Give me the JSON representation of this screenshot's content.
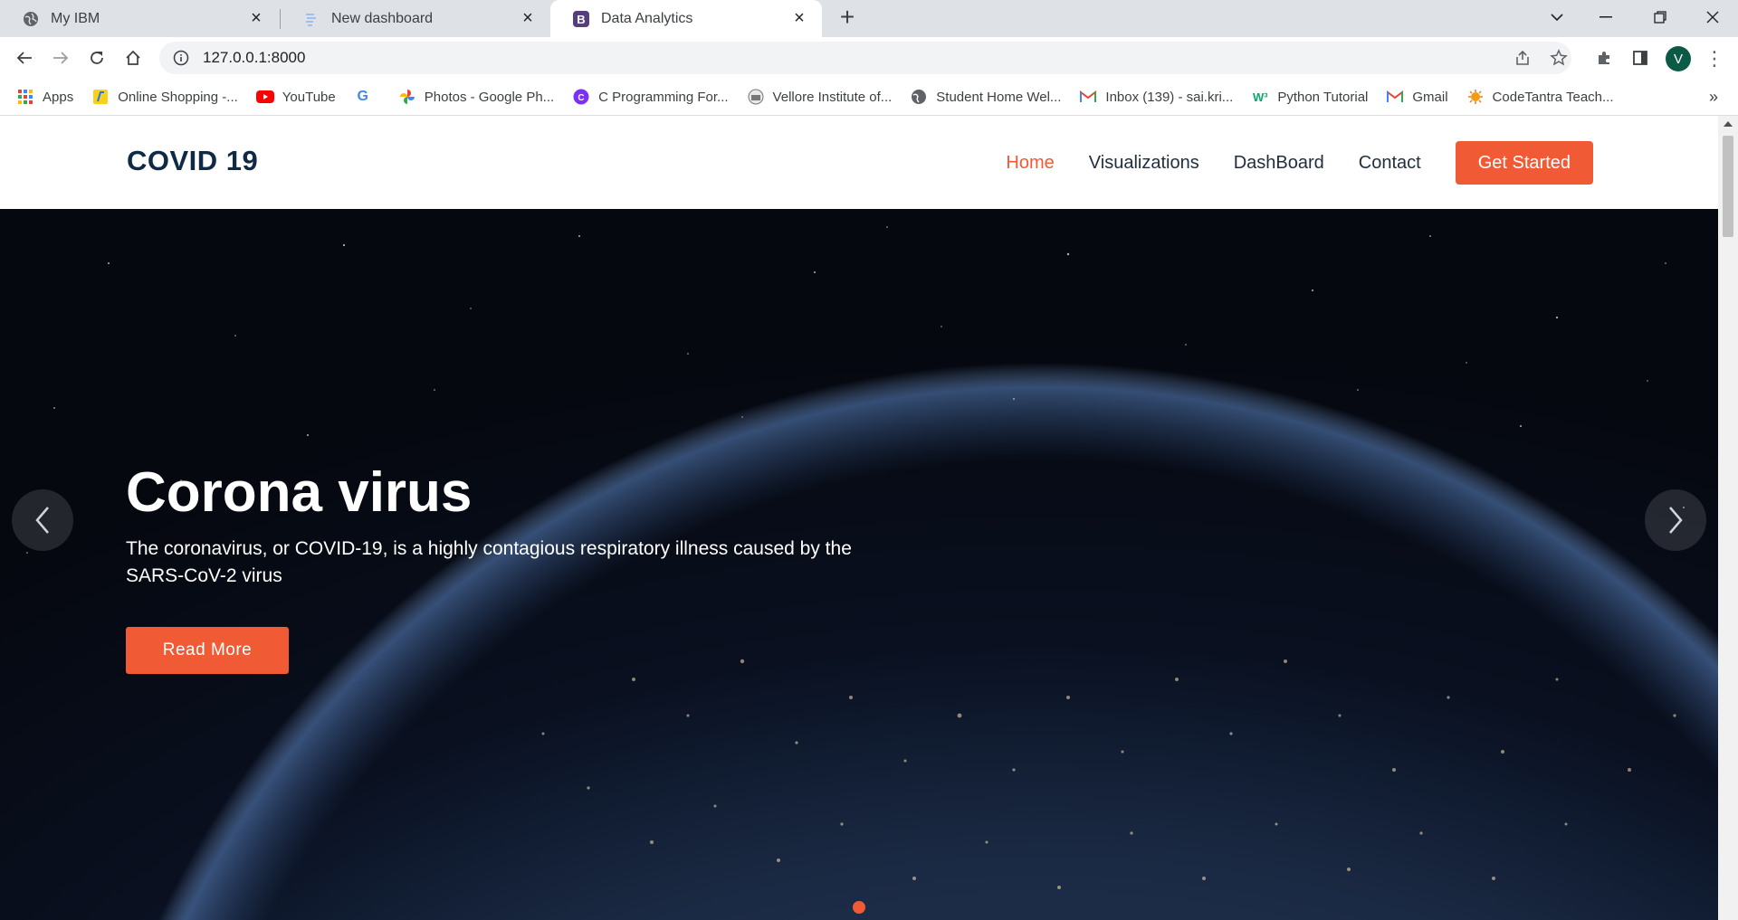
{
  "browser": {
    "tabs": [
      {
        "title": "My IBM",
        "icon": "globe-icon",
        "active": false
      },
      {
        "title": "New dashboard",
        "icon": "dashboard-icon",
        "active": false
      },
      {
        "title": "Data Analytics",
        "icon": "bootstrap-b-icon",
        "active": true
      }
    ],
    "url": "127.0.0.1:8000",
    "profile_initial": "V",
    "bookmarks": [
      {
        "label": "Apps",
        "icon": "apps-grid-icon"
      },
      {
        "label": "Online Shopping -...",
        "icon": "flipkart-icon"
      },
      {
        "label": "YouTube",
        "icon": "youtube-icon"
      },
      {
        "label": "",
        "icon": "google-icon"
      },
      {
        "label": "Photos - Google Ph...",
        "icon": "photos-icon"
      },
      {
        "label": "C Programming For...",
        "icon": "c-programming-icon"
      },
      {
        "label": "Vellore Institute of...",
        "icon": "vit-icon"
      },
      {
        "label": "Student Home Wel...",
        "icon": "globe-icon"
      },
      {
        "label": "Inbox (139) - sai.kri...",
        "icon": "gmail-icon"
      },
      {
        "label": "Python Tutorial",
        "icon": "w3-icon"
      },
      {
        "label": "Gmail",
        "icon": "gmail-icon"
      },
      {
        "label": "CodeTantra Teach...",
        "icon": "codetantra-icon"
      }
    ]
  },
  "site": {
    "logo": "COVID 19",
    "nav": [
      {
        "label": "Home",
        "active": true
      },
      {
        "label": "Visualizations",
        "active": false
      },
      {
        "label": "DashBoard",
        "active": false
      },
      {
        "label": "Contact",
        "active": false
      }
    ],
    "cta": "Get Started"
  },
  "hero": {
    "title": "Corona virus",
    "text": "The coronavirus, or COVID-19, is a highly contagious respiratory illness caused by the SARS-CoV-2 virus",
    "button": "Read More",
    "slides": 1,
    "active_slide": 1
  },
  "colors": {
    "accent": "#f05a35",
    "logo": "#0f2a44",
    "nav_text": "#1f2d3d"
  }
}
